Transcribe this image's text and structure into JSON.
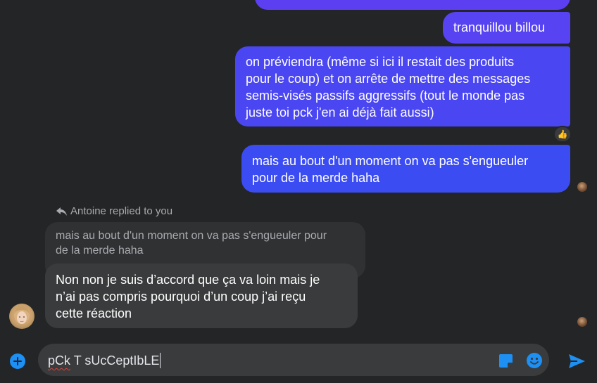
{
  "colors": {
    "background": "#242526",
    "outgoing_bubble": "#4b44f0",
    "incoming_bubble": "#3a3b3c",
    "accent_blue": "#1e8ff3",
    "muted_text": "#a8abaf"
  },
  "messages": {
    "outgoing_1": "tranquillou billou",
    "outgoing_2": "on préviendra (même si ici il restait des produits\npour le coup) et on arrête de mettre des messages\nsemis-visés passifs aggressifs (tout le monde pas\njuste toi pck j'en ai déjà fait aussi)",
    "outgoing_2_reaction": "👍",
    "outgoing_3": "mais au bout d'un moment on va pas s'engueuler\npour de la merde haha",
    "reply_label": "Antoine replied to you",
    "quoted_text": "mais au bout d'un moment on va pas s'engueuler pour\nde la merde haha",
    "incoming_1": "Non non je suis d’accord que ça va loin mais je\nn’ai pas compris pourquoi d’un coup j’ai reçu\ncette réaction"
  },
  "composer": {
    "input_value_part1": "pCk",
    "input_value_part2": " T sUcCeptIbLE",
    "icons": {
      "add": "plus-circle-icon",
      "sticker": "sticker-icon",
      "emoji": "emoji-icon",
      "send": "send-icon"
    }
  }
}
